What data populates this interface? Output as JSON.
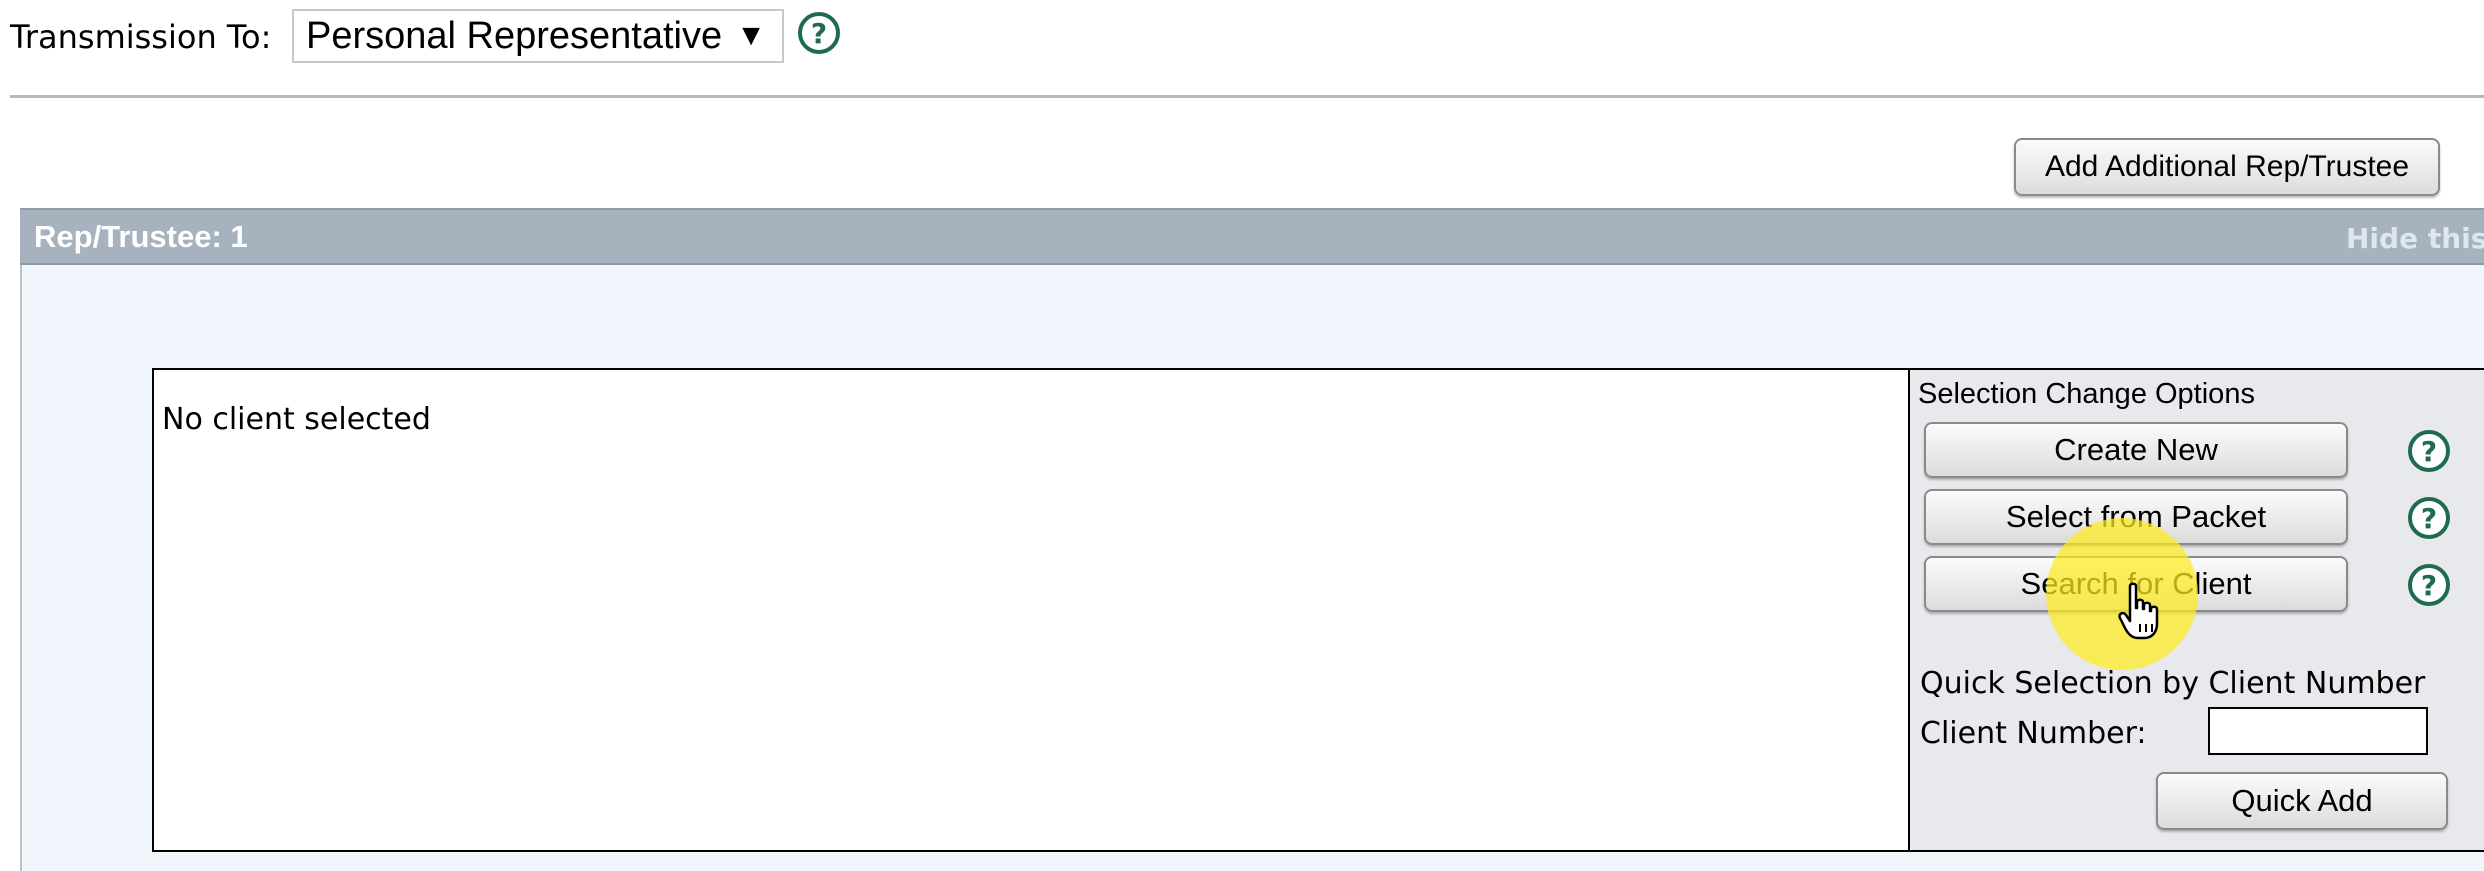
{
  "transmission": {
    "label": "Transmission To:",
    "selected": "Personal Representative",
    "arrow_glyph": "▼",
    "help_icon": "help-question-icon"
  },
  "actions": {
    "add_rep_label": "Add Additional Rep/Trustee"
  },
  "panel": {
    "title": "Rep/Trustee: 1",
    "hide_label": "Hide this",
    "header_color": "#a6b3bf",
    "background_color": "#f0f6fb"
  },
  "client": {
    "status_text": "No client selected"
  },
  "selection": {
    "heading": "Selection Change Options",
    "buttons": [
      {
        "label": "Create New",
        "help_icon": "help-question-icon"
      },
      {
        "label": "Select from Packet",
        "help_icon": "help-question-icon"
      },
      {
        "label": "Search for Client",
        "help_icon": "help-question-icon"
      }
    ]
  },
  "quick": {
    "heading": "Quick Selection by Client Number",
    "client_number_label": "Client Number:",
    "client_number_value": "",
    "add_label": "Quick Add"
  },
  "colors": {
    "help_icon_green": "#1f6b52",
    "cursor_highlight": "#ffec1e"
  }
}
